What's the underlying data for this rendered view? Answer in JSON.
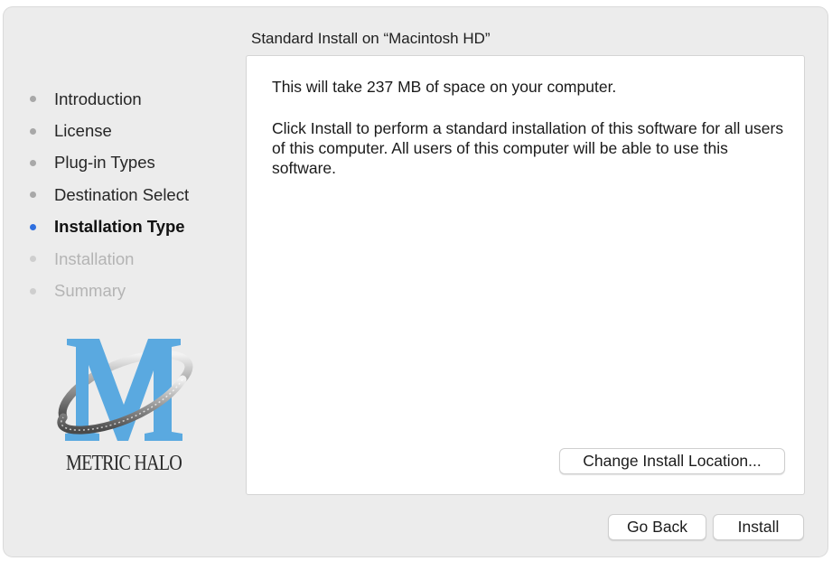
{
  "header": {
    "title": "Standard Install on “Macintosh HD”"
  },
  "sidebar": {
    "steps": [
      {
        "label": "Introduction",
        "state": "done"
      },
      {
        "label": "License",
        "state": "done"
      },
      {
        "label": "Plug-in Types",
        "state": "done"
      },
      {
        "label": "Destination Select",
        "state": "done"
      },
      {
        "label": "Installation Type",
        "state": "current"
      },
      {
        "label": "Installation",
        "state": "future"
      },
      {
        "label": "Summary",
        "state": "future"
      }
    ]
  },
  "logo": {
    "text": "METRIC HALO",
    "icon": "metric-halo-logo"
  },
  "content": {
    "space_text": "This will take 237 MB of space on your computer.",
    "description": "Click Install to perform a standard installation of this software for all users of this computer. All users of this computer will be able to use this software.",
    "change_location_label": "Change Install Location..."
  },
  "footer": {
    "go_back_label": "Go Back",
    "install_label": "Install"
  },
  "colors": {
    "current_step_dot": "#2f6fdf",
    "window_background": "#ececec",
    "logo_blue": "#5aa9e0"
  }
}
